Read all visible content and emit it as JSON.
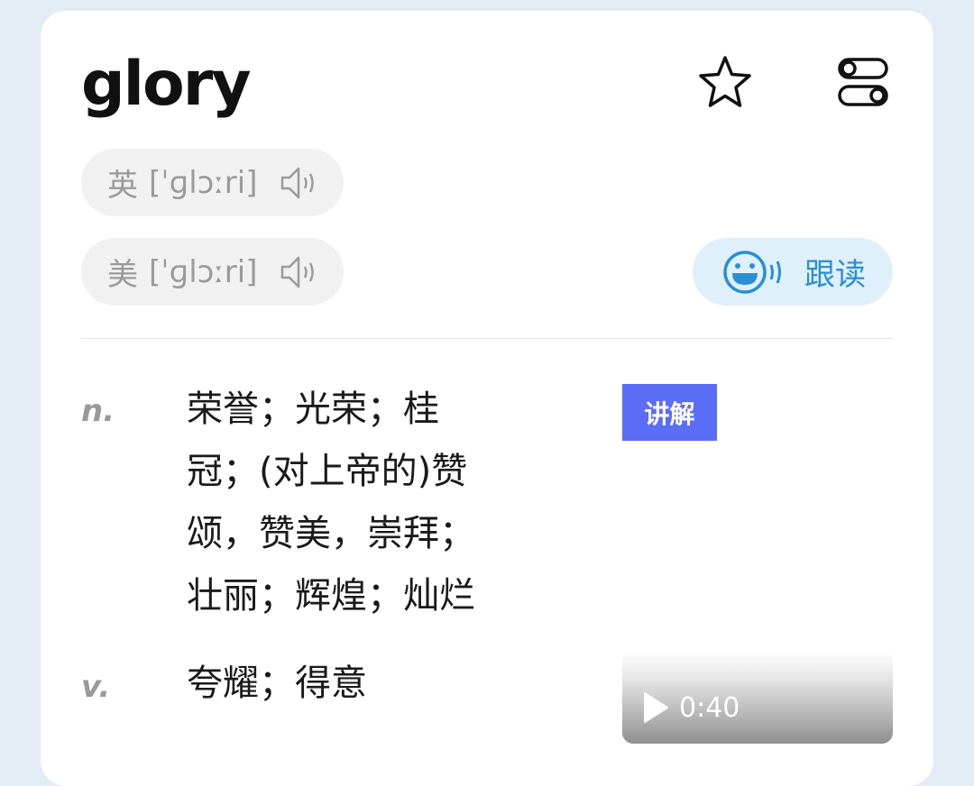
{
  "word": "glory",
  "icons": {
    "favorite": "star-icon",
    "settings": "settings-toggle-icon",
    "speaker": "speaker-icon",
    "smiley": "smiley-icon",
    "play": "play-icon"
  },
  "pronunciations": [
    {
      "label": "英",
      "ipa": "[ˈɡlɔːri]"
    },
    {
      "label": "美",
      "ipa": "[ˈɡlɔːri]"
    }
  ],
  "follow_read_label": "跟读",
  "definitions": [
    {
      "pos": "n.",
      "lines": [
        "荣誉；光荣；桂",
        "冠；(对上帝的)赞",
        "颂，赞美，崇拜；",
        "壮丽；辉煌；灿烂"
      ]
    },
    {
      "pos": "v.",
      "lines": [
        "夸耀；得意"
      ]
    }
  ],
  "explain_label": "讲解",
  "video_duration": "0:40",
  "colors": {
    "accent_blue": "#2a8fd4",
    "badge": "#5b6cf6",
    "page_bg": "#e3ebf4"
  }
}
